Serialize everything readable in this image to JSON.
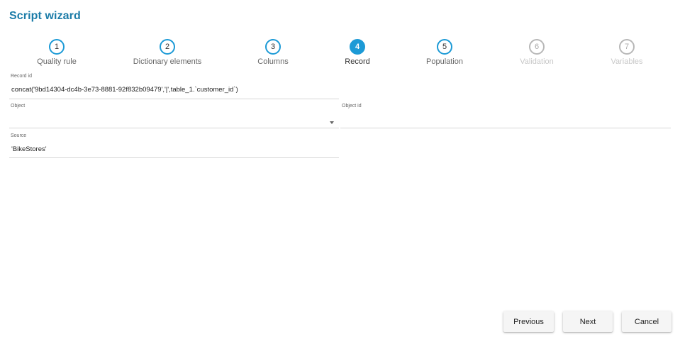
{
  "dialog": {
    "title": "Script wizard"
  },
  "steps": [
    {
      "number": "1",
      "label": "Quality rule",
      "state": "complete"
    },
    {
      "number": "2",
      "label": "Dictionary elements",
      "state": "complete"
    },
    {
      "number": "3",
      "label": "Columns",
      "state": "complete"
    },
    {
      "number": "4",
      "label": "Record",
      "state": "active"
    },
    {
      "number": "5",
      "label": "Population",
      "state": "upcoming"
    },
    {
      "number": "6",
      "label": "Validation",
      "state": "disabled"
    },
    {
      "number": "7",
      "label": "Variables",
      "state": "disabled"
    }
  ],
  "form": {
    "record_id": {
      "label": "Record id",
      "value": "concat('9bd14304-dc4b-3e73-8881-92f832b09479','|',table_1.`customer_id`)"
    },
    "object": {
      "label": "Object",
      "value": ""
    },
    "object_id": {
      "label": "Object id",
      "value": ""
    },
    "source": {
      "label": "Source",
      "value": "'BikeStores'"
    }
  },
  "buttons": {
    "previous": "Previous",
    "next": "Next",
    "cancel": "Cancel"
  },
  "colors": {
    "accent": "#1c9ad6",
    "title": "#1c7ca8",
    "disabled": "#b8b8b8"
  }
}
